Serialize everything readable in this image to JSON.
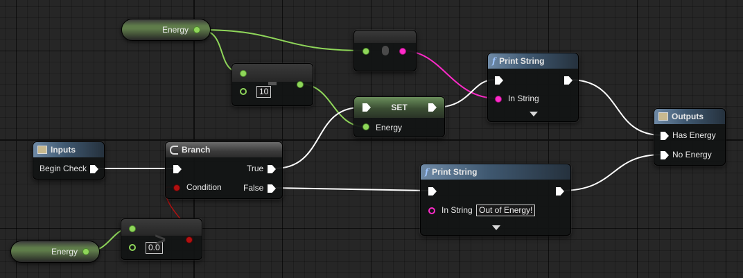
{
  "colors": {
    "exec_wire": "#ffffff",
    "float_wire": "#8fd65a",
    "string_wire": "#ff2bc9",
    "bool_wire": "#b21010",
    "function_header": "#3f5870",
    "set_header": "#3b4e33"
  },
  "variables": {
    "energy_top": "Energy",
    "energy_bottom": "Energy"
  },
  "greater_top": {
    "value": "10"
  },
  "greater_bottom": {
    "value": "0.0"
  },
  "inputs": {
    "title": "Inputs",
    "pin": "Begin Check"
  },
  "branch": {
    "title": "Branch",
    "true_label": "True",
    "false_label": "False",
    "condition_label": "Condition"
  },
  "set_node": {
    "title": "SET",
    "pin": "Energy"
  },
  "print_top": {
    "title": "Print String",
    "in_label": "In String"
  },
  "print_bottom": {
    "title": "Print String",
    "in_label": "In String",
    "value": "Out of Energy!"
  },
  "outputs": {
    "title": "Outputs",
    "pin_has": "Has Energy",
    "pin_no": "No Energy"
  },
  "icons": {
    "function": "function-icon",
    "branch": "branch-icon",
    "tunnel": "tunnel-icon"
  }
}
